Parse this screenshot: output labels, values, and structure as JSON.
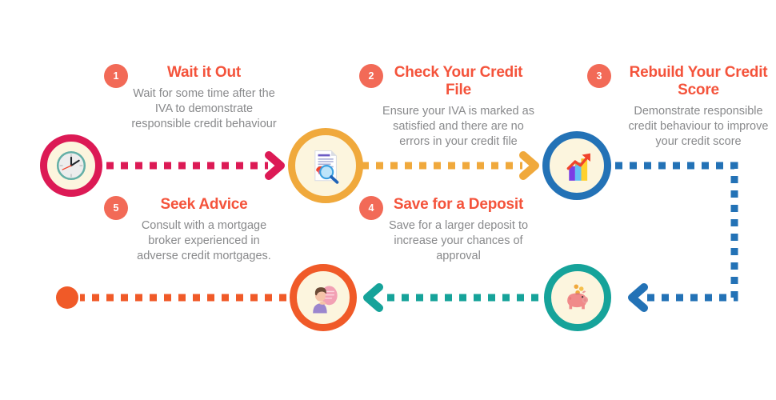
{
  "infographic": {
    "accent_colors": {
      "badge": "#F26A57",
      "title": "#F4533B",
      "body_text": "#88898B",
      "icon_bg": "#FCF5DE",
      "ring_1_crimson": "#DC1A55",
      "ring_2_orange": "#F0A93C",
      "ring_3_blue": "#2372B6",
      "ring_4_teal": "#16A39A",
      "ring_5_orangered": "#F05A28",
      "connector_1": "#DC1A55",
      "connector_2": "#F0A93C",
      "connector_3": "#2372B6",
      "connector_4": "#16A39A",
      "connector_5": "#F05A28"
    },
    "steps": [
      {
        "number": "1",
        "title": "Wait it Out",
        "description": "Wait for some time after the IVA to demonstrate responsible credit behaviour",
        "icon": "clock-icon"
      },
      {
        "number": "2",
        "title": "Check Your Credit File",
        "description": "Ensure your IVA is marked as satisfied and there are no errors in your credit file",
        "icon": "document-magnifier-icon"
      },
      {
        "number": "3",
        "title": "Rebuild Your Credit Score",
        "description": "Demonstrate responsible credit behaviour to improve your credit score",
        "icon": "growth-chart-icon"
      },
      {
        "number": "4",
        "title": "Save for a Deposit",
        "description": "Save for a larger deposit to increase your chances of approval",
        "icon": "piggy-bank-icon"
      },
      {
        "number": "5",
        "title": "Seek Advice",
        "description": "Consult with a mortgage broker experienced in adverse credit mortgages.",
        "icon": "advice-person-icon"
      }
    ]
  }
}
